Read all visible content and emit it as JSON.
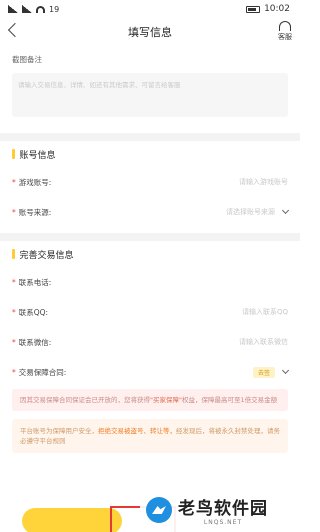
{
  "status": {
    "carrier": "19",
    "time": "10:02"
  },
  "nav": {
    "title": "填写信息",
    "service_label": "客服"
  },
  "remark": {
    "label": "截图备注",
    "placeholder": "请输入交易信息、详情、如还有其他需求、可留言给客服"
  },
  "account": {
    "title": "账号信息",
    "rows": [
      {
        "label": "游戏账号:",
        "value": "请输入游戏账号"
      },
      {
        "label": "账号来源:",
        "value": "请选择账号来源"
      }
    ]
  },
  "trade": {
    "title": "完善交易信息",
    "rows": [
      {
        "label": "联系电话:",
        "value": ""
      },
      {
        "label": "联系QQ:",
        "value": "请输入联系QQ"
      },
      {
        "label": "联系微信:",
        "value": "请输入联系微信"
      },
      {
        "label": "交易保障合同:",
        "badge": "去签"
      }
    ]
  },
  "notices": {
    "pink_text_1": "因其交易保障合同保证会已开放的，您将获得",
    "pink_highlight": "\"买家保障\"",
    "pink_text_2": "权益，保障最高可至1倍交易金额",
    "orange_text_1": "平台账号为保障用户安全，",
    "orange_highlight": "拒绝交易被盗号、转让等，",
    "orange_text_2": "经发现后，将被永久封禁处理，请务必遵守平台规则"
  },
  "watermark": {
    "name": "老鸟软件园",
    "url": "LNQS.NET"
  }
}
